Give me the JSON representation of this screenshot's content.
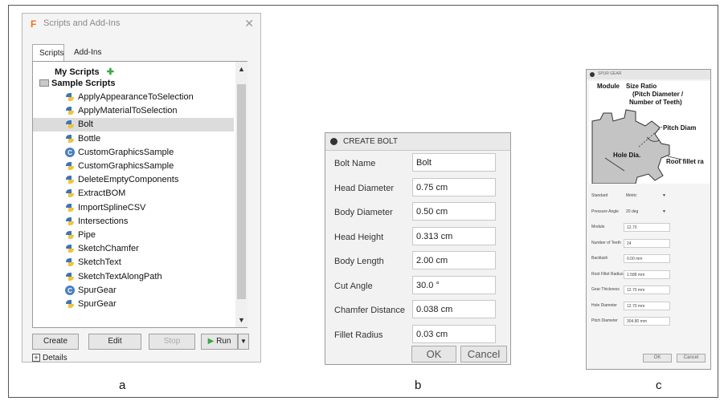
{
  "panel_a": {
    "title": "Scripts and Add-Ins",
    "tabs": [
      "Scripts",
      "Add-Ins"
    ],
    "my_scripts": "My Scripts",
    "sample_scripts": "Sample Scripts",
    "items": [
      {
        "label": "ApplyAppearanceToSelection",
        "icon": "python-icon"
      },
      {
        "label": "ApplyMaterialToSelection",
        "icon": "python-icon"
      },
      {
        "label": "Bolt",
        "icon": "python-icon",
        "selected": true
      },
      {
        "label": "Bottle",
        "icon": "python-icon"
      },
      {
        "label": "CustomGraphicsSample",
        "icon": "cpp-icon"
      },
      {
        "label": "CustomGraphicsSample",
        "icon": "python-icon"
      },
      {
        "label": "DeleteEmptyComponents",
        "icon": "python-icon"
      },
      {
        "label": "ExtractBOM",
        "icon": "python-icon"
      },
      {
        "label": "ImportSplineCSV",
        "icon": "python-icon"
      },
      {
        "label": "Intersections",
        "icon": "python-icon"
      },
      {
        "label": "Pipe",
        "icon": "python-icon"
      },
      {
        "label": "SketchChamfer",
        "icon": "python-icon"
      },
      {
        "label": "SketchText",
        "icon": "python-icon"
      },
      {
        "label": "SketchTextAlongPath",
        "icon": "python-icon"
      },
      {
        "label": "SpurGear",
        "icon": "cpp-icon"
      },
      {
        "label": "SpurGear",
        "icon": "python-icon"
      }
    ],
    "buttons": {
      "create": "Create",
      "edit": "Edit",
      "stop": "Stop",
      "run": "Run"
    },
    "details": "Details",
    "caption": "a",
    "colors": {
      "python_blue": "#3d74b5",
      "python_yellow": "#f0c33c",
      "cpp": "#4a7fc1",
      "add_green": "#3aa845",
      "run_green": "#3aa845"
    }
  },
  "panel_b": {
    "title": "CREATE BOLT",
    "fields": [
      {
        "label": "Bolt Name",
        "value": "Bolt"
      },
      {
        "label": "Head Diameter",
        "value": "0.75 cm"
      },
      {
        "label": "Body Diameter",
        "value": "0.50 cm"
      },
      {
        "label": "Head Height",
        "value": "0.313 cm"
      },
      {
        "label": "Body Length",
        "value": "2.00 cm"
      },
      {
        "label": "Cut Angle",
        "value": "30.0 °"
      },
      {
        "label": "Chamfer Distance",
        "value": "0.038 cm"
      },
      {
        "label": "Fillet Radius",
        "value": "0.03 cm"
      }
    ],
    "ok": "OK",
    "cancel": "Cancel",
    "caption": "b"
  },
  "panel_c": {
    "title": "SPUR GEAR",
    "image_labels": {
      "module": "Module",
      "size_ratio": "Size Ratio",
      "pitch_paren": "(Pitch Diameter /",
      "teeth": "Number of Teeth)",
      "pitch_diam": "Pitch Diam",
      "hole_dia": "Hole Dia.",
      "root_fillet": "Root fillet ra"
    },
    "fields": [
      {
        "label": "Standard",
        "value": "Metric",
        "dropdown": true
      },
      {
        "label": "Pressure Angle",
        "value": "20 deg",
        "dropdown": true
      },
      {
        "label": "Module",
        "value": "12.70"
      },
      {
        "label": "Number of Teeth",
        "value": "24"
      },
      {
        "label": "Backlash",
        "value": "0.00 mm"
      },
      {
        "label": "Root Fillet Radius",
        "value": "1.588 mm"
      },
      {
        "label": "Gear Thickness",
        "value": "12.70 mm"
      },
      {
        "label": "Hole Diameter",
        "value": "12.70 mm"
      },
      {
        "label": "Pitch Diameter",
        "value": "304.80 mm"
      }
    ],
    "ok": "OK",
    "cancel": "Cancel",
    "caption": "c"
  }
}
